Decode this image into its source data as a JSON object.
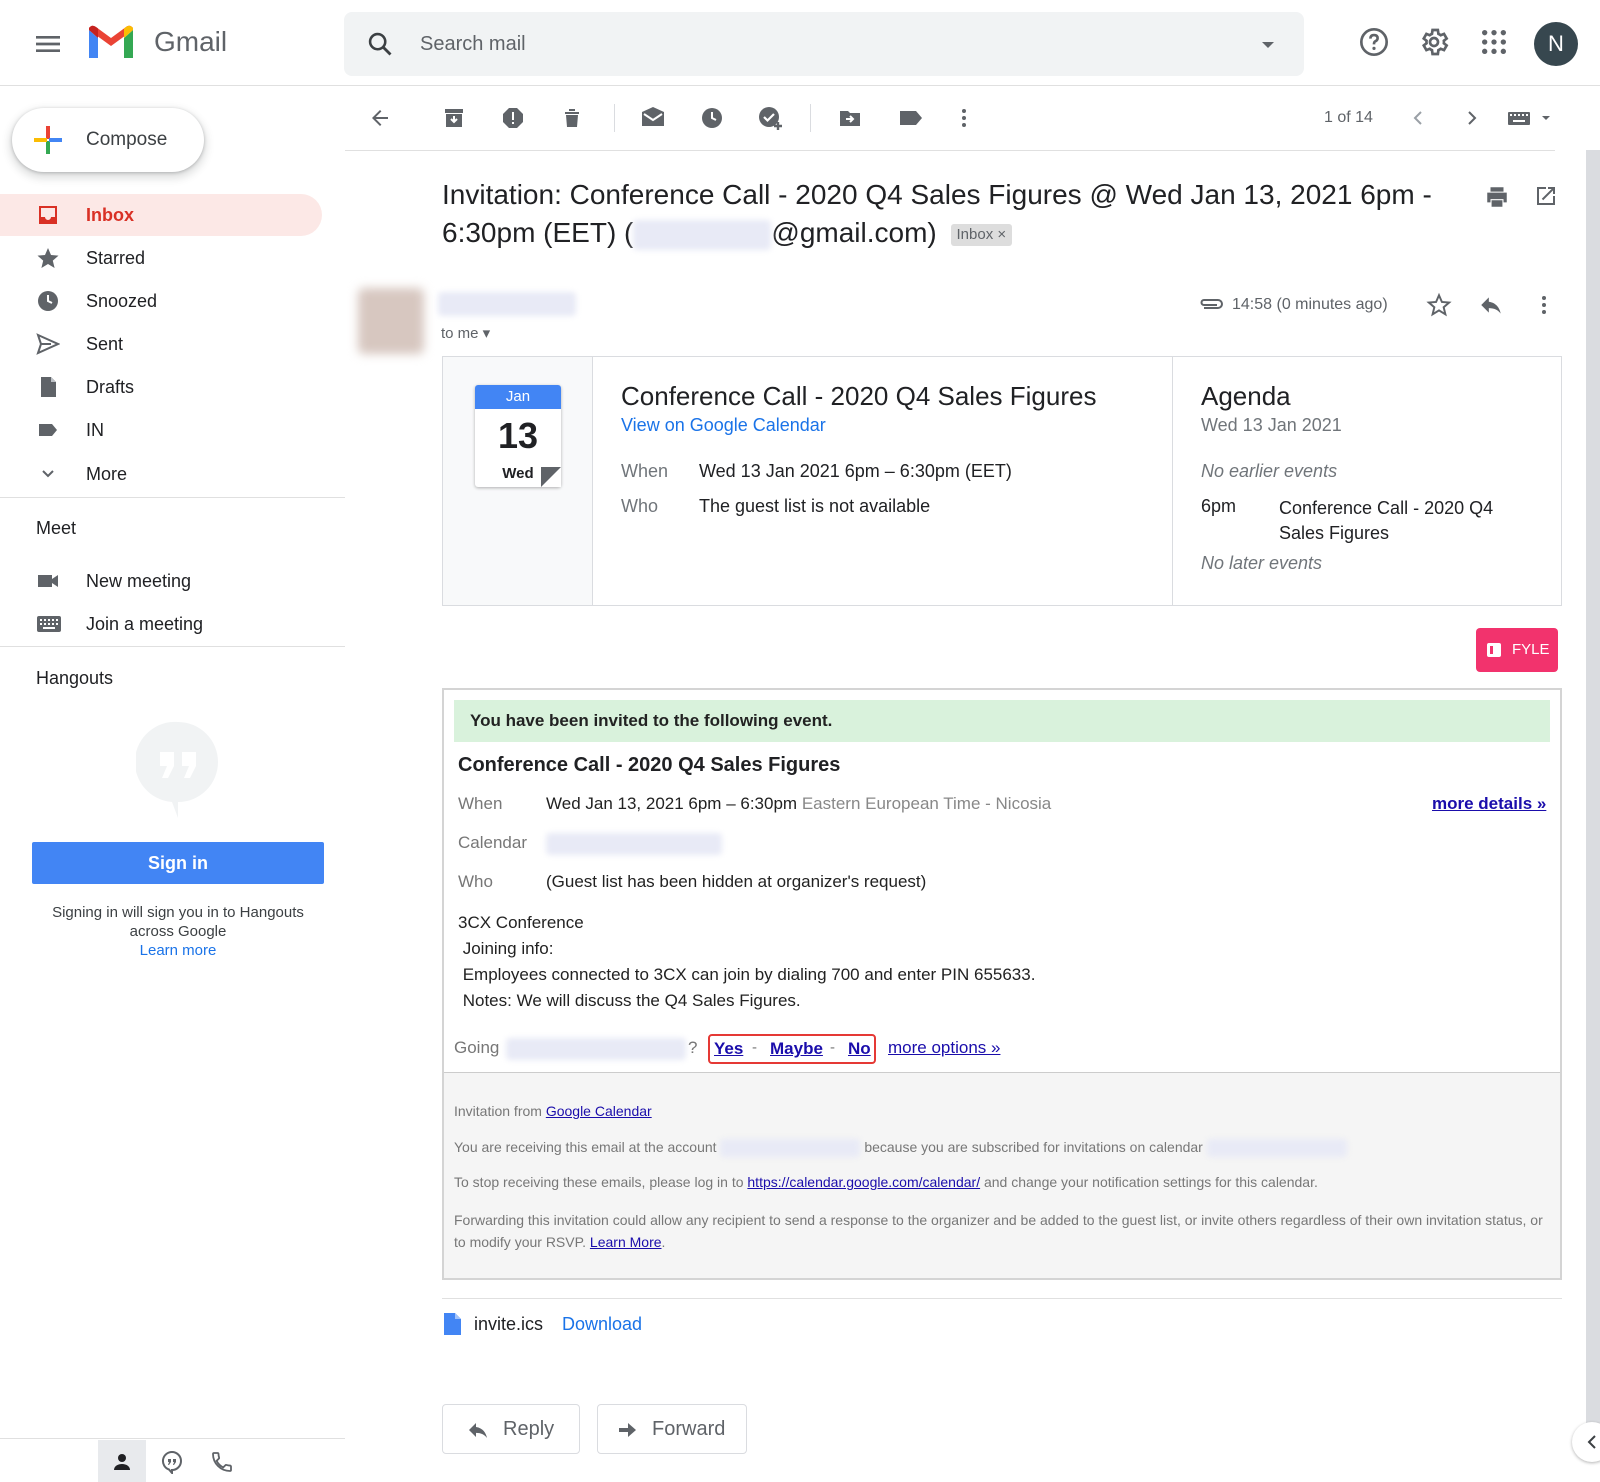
{
  "header": {
    "app_name": "Gmail",
    "search_placeholder": "Search mail",
    "avatar_letter": "N"
  },
  "sidebar": {
    "compose_label": "Compose",
    "items": [
      {
        "label": "Inbox",
        "icon": "inbox-icon",
        "active": true
      },
      {
        "label": "Starred",
        "icon": "star-icon"
      },
      {
        "label": "Snoozed",
        "icon": "clock-icon"
      },
      {
        "label": "Sent",
        "icon": "send-icon"
      },
      {
        "label": "Drafts",
        "icon": "draft-icon"
      },
      {
        "label": "IN",
        "icon": "label-icon"
      },
      {
        "label": "More",
        "icon": "chevron-down-icon"
      }
    ],
    "meet": {
      "title": "Meet",
      "new_meeting": "New meeting",
      "join_meeting": "Join a meeting"
    },
    "hangouts": {
      "title": "Hangouts",
      "sign_in": "Sign in",
      "note": "Signing in will sign you in to Hangouts across Google",
      "learn_more": "Learn more"
    }
  },
  "toolbar": {
    "pager": "1 of 14"
  },
  "email": {
    "subject_prefix": "Invitation: Conference Call - 2020 Q4 Sales Figures @ Wed Jan 13, 2021 6pm - 6:30pm (EET) (",
    "subject_suffix": "@gmail.com)",
    "inbox_chip": "Inbox",
    "to_me": "to me",
    "time": "14:58 (0 minutes ago)"
  },
  "card": {
    "cal_month": "Jan",
    "cal_day": "13",
    "cal_dow": "Wed",
    "title": "Conference Call - 2020 Q4 Sales Figures",
    "view_link": "View on Google Calendar",
    "when_label": "When",
    "when_value": "Wed 13 Jan 2021 6pm – 6:30pm (EET)",
    "who_label": "Who",
    "who_value": "The guest list is not available",
    "agenda_title": "Agenda",
    "agenda_date": "Wed 13 Jan 2021",
    "no_earlier": "No earlier events",
    "agenda_time": "6pm",
    "agenda_event": "Conference Call - 2020 Q4 Sales Figures",
    "no_later": "No later events"
  },
  "fyle_label": "FYLE",
  "invite": {
    "banner": "You have been invited to the following event.",
    "title": "Conference Call - 2020 Q4 Sales Figures",
    "when_label": "When",
    "when_value": "Wed Jan 13, 2021 6pm – 6:30pm",
    "timezone": "Eastern European Time - Nicosia",
    "more_details": "more details »",
    "calendar_label": "Calendar",
    "who_label": "Who",
    "who_value": "(Guest list has been hidden at organizer's request)",
    "desc1": "3CX Conference",
    "desc2": " Joining info:",
    "desc3": " Employees connected to 3CX can join by dialing 700 and enter PIN 655633.",
    "desc4": " Notes: We will discuss the Q4 Sales Figures.",
    "going": "Going",
    "q": "?",
    "yes": "Yes",
    "maybe": "Maybe",
    "no": "No",
    "dash": "-",
    "more_options": "more options »",
    "footer_from": "Invitation from",
    "footer_from_link": "Google Calendar",
    "footer_recv1": "You are receiving this email at the account",
    "footer_recv2": "because you are subscribed for invitations on calendar",
    "footer_stop1": "To stop receiving these emails, please log in to",
    "footer_stop_link": "https://calendar.google.com/calendar/",
    "footer_stop2": "and change your notification settings for this calendar.",
    "footer_fwd": "Forwarding this invitation could allow any recipient to send a response to the organizer and be added to the guest list, or invite others regardless of their own invitation status, or to modify your RSVP.",
    "footer_learn": "Learn More"
  },
  "attachment": {
    "name": "invite.ics",
    "download": "Download"
  },
  "actions": {
    "reply": "Reply",
    "forward": "Forward"
  }
}
